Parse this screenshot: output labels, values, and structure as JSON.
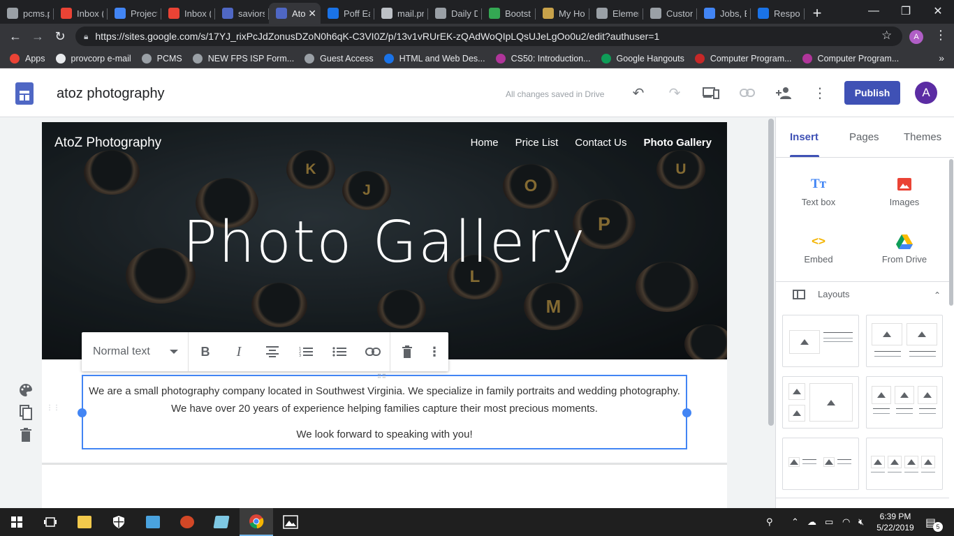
{
  "browser": {
    "tabs": [
      {
        "label": "pcms.p",
        "icon": "globe-icon",
        "color": "#9aa0a6"
      },
      {
        "label": "Inbox (",
        "icon": "gmail-icon",
        "color": "#ea4335"
      },
      {
        "label": "Project",
        "icon": "info-icon",
        "color": "#4285f4"
      },
      {
        "label": "Inbox (",
        "icon": "gmail-icon",
        "color": "#ea4335"
      },
      {
        "label": "saviors",
        "icon": "sites-icon",
        "color": "#4f67c4"
      },
      {
        "label": "Ato",
        "icon": "sites-icon",
        "color": "#4f67c4",
        "close": "✕"
      },
      {
        "label": "Poff Ea",
        "icon": "p-icon",
        "color": "#1a73e8"
      },
      {
        "label": "mail.pr",
        "icon": "doc-icon",
        "color": "#bdc1c6"
      },
      {
        "label": "Daily D",
        "icon": "feather-icon",
        "color": "#9aa0a6"
      },
      {
        "label": "Bootst",
        "icon": "chart-icon",
        "color": "#34a853"
      },
      {
        "label": "My Ho",
        "icon": "wine-icon",
        "color": "#c8a24a"
      },
      {
        "label": "Elemen",
        "icon": "globe-icon",
        "color": "#9aa0a6"
      },
      {
        "label": "Custon",
        "icon": "globe-icon",
        "color": "#9aa0a6"
      },
      {
        "label": "Jobs, E",
        "icon": "info-icon",
        "color": "#4285f4"
      },
      {
        "label": "Respo",
        "icon": "form-icon",
        "color": "#1a73e8"
      }
    ],
    "new_tab": "+",
    "url": "https://sites.google.com/s/17YJ_rixPcJdZonusDZoN0h6qK-C3VI0Z/p/13v1vRUrEK-zQAdWoQIpLQsUJeLgOo0u2/edit?authuser=1",
    "profile_initial": "A",
    "bookmarks": [
      {
        "label": "Apps",
        "icon": "apps-grid-icon",
        "color": "#ea4335"
      },
      {
        "label": "provcorp e-mail",
        "icon": "doc-icon",
        "color": "#e8eaed"
      },
      {
        "label": "PCMS",
        "icon": "globe-icon",
        "color": "#9aa0a6"
      },
      {
        "label": "NEW FPS ISP Form...",
        "icon": "globe-icon",
        "color": "#9aa0a6"
      },
      {
        "label": "Guest Access",
        "icon": "globe-icon",
        "color": "#9aa0a6"
      },
      {
        "label": "HTML and Web Des...",
        "icon": "bookmark-icon",
        "color": "#1a73e8"
      },
      {
        "label": "CS50: Introduction...",
        "icon": "edx-icon",
        "color": "#b0359a"
      },
      {
        "label": "Google Hangouts",
        "icon": "hangouts-icon",
        "color": "#0f9d58"
      },
      {
        "label": "Computer Program...",
        "icon": "star-flag-icon",
        "color": "#c62828"
      },
      {
        "label": "Computer Program...",
        "icon": "edx-icon",
        "color": "#b0359a"
      }
    ]
  },
  "sites": {
    "site_name": "atoz photography",
    "save_status": "All changes saved in Drive",
    "publish_label": "Publish",
    "avatar_initial": "A"
  },
  "page": {
    "brand": "AtoZ Photography",
    "nav": [
      "Home",
      "Price List",
      "Contact Us",
      "Photo Gallery"
    ],
    "current_nav": "Photo Gallery",
    "hero_title": "Photo Gallery",
    "hero_keys": [
      "O",
      "P",
      "L",
      "M",
      "K",
      "J",
      "U"
    ],
    "paragraph1": "We are a small photography company located in Southwest Virginia.  We specialize in family portraits and wedding photography. We have over 20 years of experience helping families capture their most precious moments.",
    "paragraph2": "We look forward to speaking with you!"
  },
  "format_toolbar": {
    "style_value": "Normal text"
  },
  "panel": {
    "tabs": [
      "Insert",
      "Pages",
      "Themes"
    ],
    "active_tab": "Insert",
    "insert_items": [
      {
        "label": "Text box",
        "icon": "text-box-icon",
        "glyph": "Tт",
        "color": "#4285f4"
      },
      {
        "label": "Images",
        "icon": "image-icon",
        "glyph": "▲",
        "color": "#ea4335"
      },
      {
        "label": "Embed",
        "icon": "embed-icon",
        "glyph": "<>",
        "color": "#f4b400"
      },
      {
        "label": "From Drive",
        "icon": "drive-icon",
        "glyph": "▲",
        "color": "#34a853"
      }
    ],
    "layouts_label": "Layouts"
  },
  "taskbar": {
    "time": "6:39 PM",
    "date": "5/22/2019",
    "notification_count": "5"
  }
}
